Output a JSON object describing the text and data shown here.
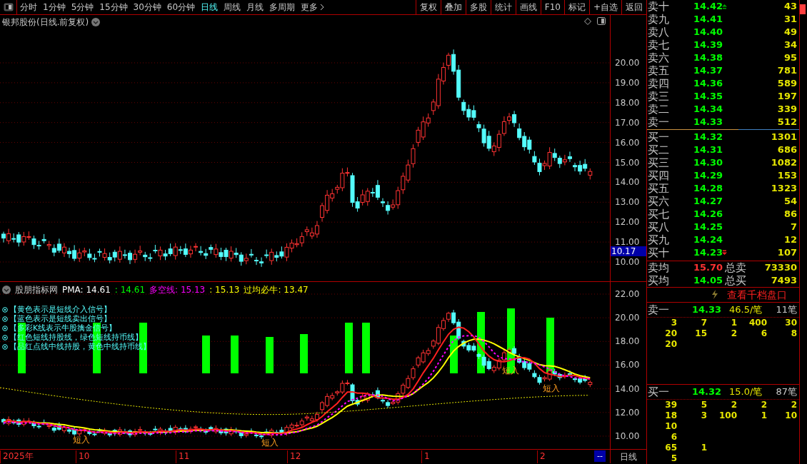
{
  "toolbar": {
    "periods": [
      {
        "label": "分时",
        "selected": false
      },
      {
        "label": "1分钟",
        "selected": false
      },
      {
        "label": "5分钟",
        "selected": false
      },
      {
        "label": "15分钟",
        "selected": false
      },
      {
        "label": "30分钟",
        "selected": false
      },
      {
        "label": "60分钟",
        "selected": false
      },
      {
        "label": "日线",
        "selected": true
      },
      {
        "label": "周线",
        "selected": false
      },
      {
        "label": "月线",
        "selected": false
      },
      {
        "label": "多周期",
        "selected": false
      },
      {
        "label": "更多",
        "selected": false
      }
    ],
    "actions": [
      "复权",
      "叠加",
      "多股",
      "统计",
      "画线",
      "F10",
      "标记",
      "+自选",
      "返回"
    ]
  },
  "chart": {
    "title": "银邦股份(日线.前复权)",
    "price_axis": [
      "20.00",
      "19.00",
      "18.00",
      "17.00",
      "16.00",
      "15.00",
      "14.00",
      "13.00",
      "12.00",
      "11.00",
      "10.00"
    ],
    "current_price": "10.17"
  },
  "indicator": {
    "name": "股朋指标网",
    "values": [
      {
        "text": "PMA: 14.61",
        "color": "#ffffff"
      },
      {
        "text": ": 14.61",
        "color": "#00ff00"
      },
      {
        "text": "多空线: 15.13",
        "color": "#ff00ff"
      },
      {
        "text": ": 15.13",
        "color": "#ffff00"
      },
      {
        "text": "过均必牛: 13.47",
        "color": "#ffff00"
      }
    ],
    "legend": [
      "【黄色表示是短线介入信号】",
      "【蓝色表示是短线卖出信号】",
      "【多彩K线表示牛股擒金信号】",
      "【红色短线持股线，绿色短线持币线】",
      "【品红点线中线持股，黄色中线持币线】"
    ],
    "signals": [
      "短入",
      "短入",
      "短入",
      "短入"
    ],
    "axis": [
      "22.00",
      "20.00",
      "18.00",
      "16.00",
      "14.00",
      "12.00",
      "10.00"
    ]
  },
  "date_axis": {
    "labels": [
      "2025年",
      "10",
      "11",
      "12",
      "1",
      "2"
    ],
    "page": "--",
    "period": "日线"
  },
  "order_book": {
    "asks": [
      {
        "label": "卖十",
        "price": "14.42",
        "volume": "43"
      },
      {
        "label": "卖九",
        "price": "14.41",
        "volume": "31"
      },
      {
        "label": "卖八",
        "price": "14.40",
        "volume": "49"
      },
      {
        "label": "卖七",
        "price": "14.39",
        "volume": "34"
      },
      {
        "label": "卖六",
        "price": "14.38",
        "volume": "95"
      },
      {
        "label": "卖五",
        "price": "14.37",
        "volume": "781"
      },
      {
        "label": "卖四",
        "price": "14.36",
        "volume": "589"
      },
      {
        "label": "卖三",
        "price": "14.35",
        "volume": "197"
      },
      {
        "label": "卖二",
        "price": "14.34",
        "volume": "339"
      },
      {
        "label": "卖一",
        "price": "14.33",
        "volume": "512"
      }
    ],
    "bids": [
      {
        "label": "买一",
        "price": "14.32",
        "volume": "1301"
      },
      {
        "label": "买二",
        "price": "14.31",
        "volume": "686"
      },
      {
        "label": "买三",
        "price": "14.30",
        "volume": "1082"
      },
      {
        "label": "买四",
        "price": "14.29",
        "volume": "153"
      },
      {
        "label": "买五",
        "price": "14.28",
        "volume": "1323"
      },
      {
        "label": "买六",
        "price": "14.27",
        "volume": "54"
      },
      {
        "label": "买七",
        "price": "14.26",
        "volume": "86"
      },
      {
        "label": "买八",
        "price": "14.25",
        "volume": "7"
      },
      {
        "label": "买九",
        "price": "14.24",
        "volume": "12"
      },
      {
        "label": "买十",
        "price": "14.23",
        "volume": "107"
      }
    ],
    "summary": [
      {
        "kind": "sell",
        "label": "卖均",
        "price": "15.70",
        "total_label": "总卖",
        "total": "73330"
      },
      {
        "kind": "buy",
        "label": "买均",
        "price": "14.05",
        "total_label": "总买",
        "total": "7493"
      }
    ],
    "depth_link": "查看千档盘口",
    "queues": [
      {
        "label": "卖一",
        "price": "14.33",
        "average": "46.5/笔",
        "count": "11笔",
        "rows": [
          [
            "3",
            "7",
            "1",
            "400",
            "30"
          ],
          [
            "20",
            "15",
            "2",
            "6",
            "8"
          ],
          [
            "20"
          ]
        ]
      },
      {
        "label": "买一",
        "price": "14.32",
        "average": "15.0/笔",
        "count": "87笔",
        "rows": [
          [
            "39",
            "5",
            "2",
            "2",
            "2"
          ],
          [
            "18",
            "3",
            "100",
            "1",
            "10"
          ],
          [
            "10"
          ],
          [
            "6"
          ],
          [
            "65",
            "1"
          ],
          [
            "5"
          ]
        ]
      }
    ]
  }
}
